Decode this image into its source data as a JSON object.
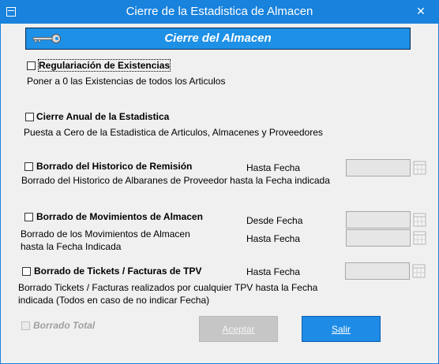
{
  "window": {
    "title": "Cierre de la Estadistica de Almacen",
    "close_glyph": "✕",
    "app_icon": "window-icon"
  },
  "header": {
    "title": "Cierre del Almacen",
    "icon": "key-icon"
  },
  "sections": {
    "regularizacion": {
      "label": "Regulariación de Existencias",
      "desc": "Poner a 0 las Existencias de todos los Articulos",
      "checked": false
    },
    "cierre_anual": {
      "label": "Cierre Anual de la Estadistica",
      "desc": "Puesta a Cero de la Estadistica de Articulos, Almacenes y Proveedores",
      "checked": false
    },
    "borrado_historico": {
      "label": "Borrado del Historico de Remisión",
      "date_label": "Hasta Fecha",
      "date_value": "",
      "desc": "Borrado del Historico de Albaranes de Proveedor hasta la Fecha indicada",
      "checked": false
    },
    "borrado_movimientos": {
      "label": "Borrado de Movimientos de Almacen",
      "from_label": "Desde Fecha",
      "from_value": "",
      "to_label": "Hasta Fecha",
      "to_value": "",
      "desc_line1": "Borrado de los Movimientos de Almacen",
      "desc_line2": "hasta la Fecha Indicada",
      "checked": false
    },
    "borrado_tickets": {
      "label": "Borrado de Tickets / Facturas de TPV",
      "date_label": "Hasta Fecha",
      "date_value": "",
      "desc_line1": "Borrado Tickets / Facturas realizados por cualquier TPV hasta la Fecha",
      "desc_line2": "indicada (Todos en caso de no indicar Fecha)",
      "checked": false
    },
    "borrado_total": {
      "label": "Borrado Total",
      "checked": false,
      "enabled": false
    }
  },
  "buttons": {
    "accept": "Aceptar",
    "exit": "Salir"
  },
  "colors": {
    "titlebar": "#1882dc",
    "header_panel": "#1e90e6",
    "primary_button": "#1e8ce6"
  }
}
